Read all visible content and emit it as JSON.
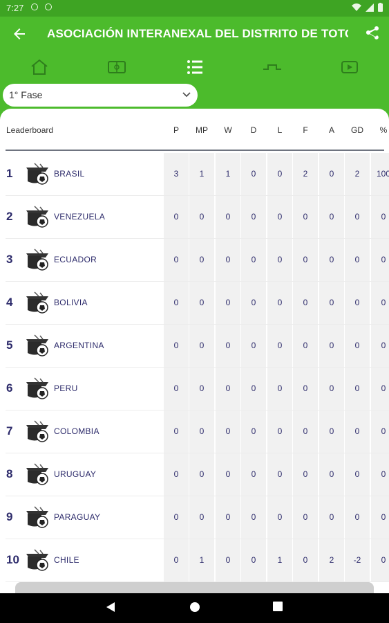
{
  "status_bar": {
    "time": "7:27"
  },
  "app_bar": {
    "title": "ASOCIACIÓN INTERANEXAL DEL DISTRITO DE TOTORA"
  },
  "tabs": [
    {
      "icon": "home-icon"
    },
    {
      "icon": "field-icon"
    },
    {
      "icon": "list-icon",
      "active": true
    },
    {
      "icon": "bracket-icon"
    },
    {
      "icon": "video-icon"
    }
  ],
  "phase_select": {
    "value": "1° Fase"
  },
  "table": {
    "leaderboard_label": "Leaderboard",
    "columns": [
      "P",
      "MP",
      "W",
      "D",
      "L",
      "F",
      "A",
      "GD",
      "%"
    ],
    "rows": [
      {
        "pos": "1",
        "team": "BRASIL",
        "values": [
          "3",
          "1",
          "1",
          "0",
          "0",
          "2",
          "0",
          "2",
          "100"
        ]
      },
      {
        "pos": "2",
        "team": "VENEZUELA",
        "values": [
          "0",
          "0",
          "0",
          "0",
          "0",
          "0",
          "0",
          "0",
          "0"
        ]
      },
      {
        "pos": "3",
        "team": "ECUADOR",
        "values": [
          "0",
          "0",
          "0",
          "0",
          "0",
          "0",
          "0",
          "0",
          "0"
        ]
      },
      {
        "pos": "4",
        "team": "BOLIVIA",
        "values": [
          "0",
          "0",
          "0",
          "0",
          "0",
          "0",
          "0",
          "0",
          "0"
        ]
      },
      {
        "pos": "5",
        "team": "ARGENTINA",
        "values": [
          "0",
          "0",
          "0",
          "0",
          "0",
          "0",
          "0",
          "0",
          "0"
        ]
      },
      {
        "pos": "6",
        "team": "PERU",
        "values": [
          "0",
          "0",
          "0",
          "0",
          "0",
          "0",
          "0",
          "0",
          "0"
        ]
      },
      {
        "pos": "7",
        "team": "COLOMBIA",
        "values": [
          "0",
          "0",
          "0",
          "0",
          "0",
          "0",
          "0",
          "0",
          "0"
        ]
      },
      {
        "pos": "8",
        "team": "URUGUAY",
        "values": [
          "0",
          "0",
          "0",
          "0",
          "0",
          "0",
          "0",
          "0",
          "0"
        ]
      },
      {
        "pos": "9",
        "team": "PARAGUAY",
        "values": [
          "0",
          "0",
          "0",
          "0",
          "0",
          "0",
          "0",
          "0",
          "0"
        ]
      },
      {
        "pos": "10",
        "team": "CHILE",
        "values": [
          "0",
          "1",
          "0",
          "0",
          "1",
          "0",
          "2",
          "-2",
          "0"
        ]
      }
    ]
  },
  "colors": {
    "brand_green": "#4cbb2c",
    "text_navy": "#2d2b6b"
  }
}
